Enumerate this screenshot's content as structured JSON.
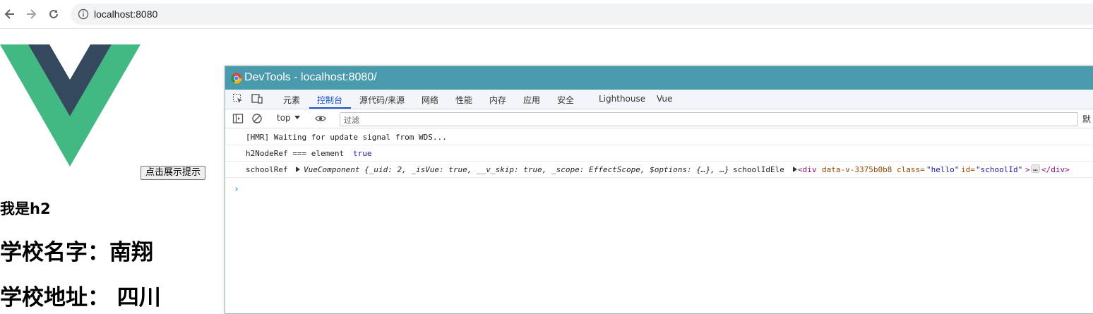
{
  "browser": {
    "url": "localhost:8080",
    "back_icon": "arrow-left-icon",
    "forward_icon": "arrow-right-icon",
    "reload_icon": "reload-icon",
    "info_icon": "info-icon"
  },
  "page": {
    "button_label": "点击展示提示",
    "h2_text": "我是h2",
    "school_name": "学校名字：南翔",
    "school_address": "学校地址： 四川"
  },
  "devtools": {
    "title": "DevTools - localhost:8080/",
    "tabs": [
      "元素",
      "控制台",
      "源代码/来源",
      "网络",
      "性能",
      "内存",
      "应用",
      "安全",
      "Lighthouse",
      "Vue"
    ],
    "active_tab": "控制台",
    "context": "top",
    "filter_placeholder": "过滤",
    "right_label_cut": "默",
    "console": {
      "line1": "[HMR] Waiting for update signal from WDS...",
      "line2_label": "h2NodeRef === element",
      "line2_value": "true",
      "line3_label": "schoolRef",
      "line3_component": "VueComponent {_uid: 2, _isVue: true, __v_skip: true, _scope: EffectScope, $options: {…}, …}",
      "line3_ele_label": "schoolIdEle",
      "line3_tag_open": "<div",
      "line3_attr1": "data-v-3375b0b8",
      "line3_attr2_name": "class=",
      "line3_attr2_value": "\"hello\"",
      "line3_attr3_name": "id=",
      "line3_attr3_value": "\"schoolId\"",
      "line3_tag_close": ">",
      "line3_ellipsis": "…",
      "line3_end_tag": "</div>"
    }
  },
  "colors": {
    "vue_green": "#42b883",
    "vue_dark": "#35495e",
    "devtools_titlebar": "#4a9aad",
    "active_tab": "#1a56c5"
  }
}
